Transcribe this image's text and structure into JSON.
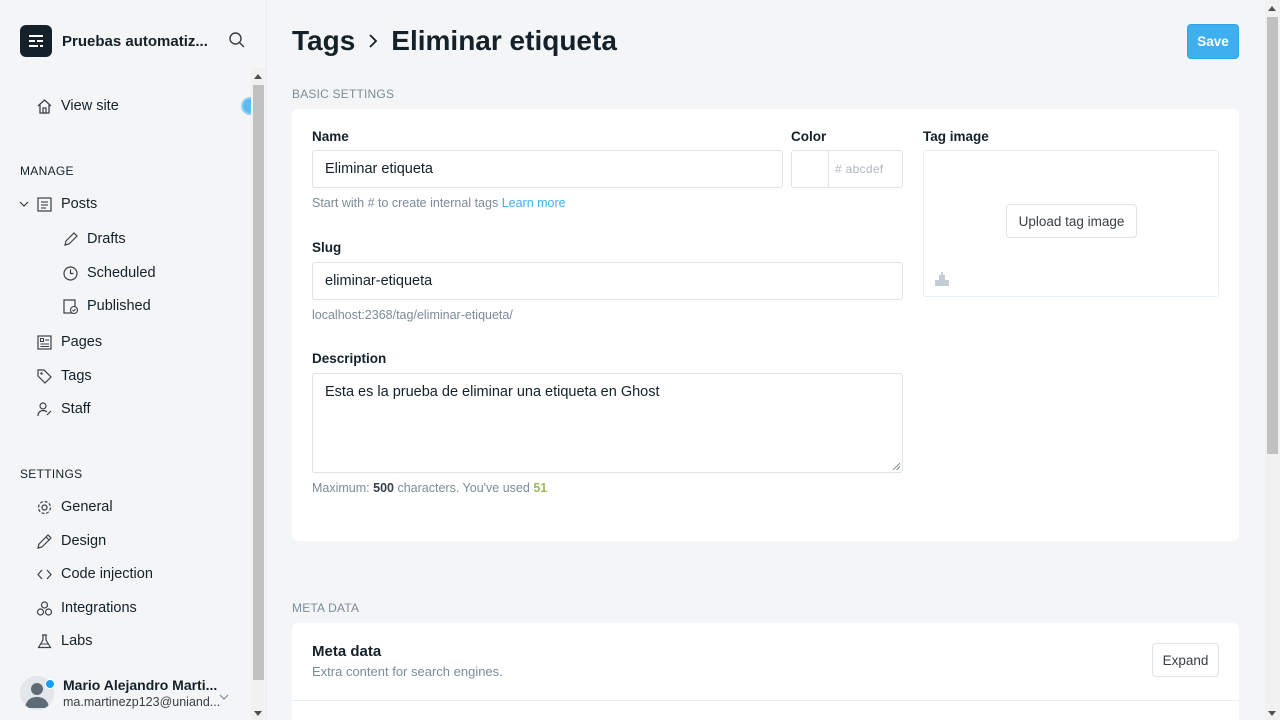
{
  "sidebar": {
    "blog_title": "Pruebas automatiz...",
    "view_site": "View site",
    "manage_heading": "MANAGE",
    "posts": "Posts",
    "drafts": "Drafts",
    "scheduled": "Scheduled",
    "published": "Published",
    "pages": "Pages",
    "tags": "Tags",
    "staff": "Staff",
    "settings_heading": "SETTINGS",
    "general": "General",
    "design": "Design",
    "code_injection": "Code injection",
    "integrations": "Integrations",
    "labs": "Labs",
    "user_name": "Mario Alejandro Marti...",
    "user_email": "ma.martinezp123@uniand..."
  },
  "header": {
    "breadcrumb_parent": "Tags",
    "breadcrumb_current": "Eliminar etiqueta",
    "save_label": "Save"
  },
  "basic": {
    "section_label": "BASIC SETTINGS",
    "name_label": "Name",
    "name_value": "Eliminar etiqueta",
    "name_hint": "Start with # to create internal tags",
    "learn_more": "Learn more",
    "color_label": "Color",
    "color_placeholder": "# abcdef",
    "tag_image_label": "Tag image",
    "upload_label": "Upload tag image",
    "slug_label": "Slug",
    "slug_value": "eliminar-etiqueta",
    "slug_url": "localhost:2368/tag/eliminar-etiqueta/",
    "description_label": "Description",
    "description_value": "Esta es la prueba de eliminar una etiqueta en Ghost",
    "max_prefix": "Maximum:",
    "max_value": "500",
    "max_suffix": "characters. You've used",
    "used_value": "51"
  },
  "meta": {
    "section_label": "META DATA",
    "title": "Meta data",
    "subtitle": "Extra content for search engines.",
    "expand_label": "Expand"
  },
  "colors": {
    "accent": "#3eb0ef",
    "counter_green": "#9fbb58"
  },
  "icons": [
    "search-icon",
    "home-icon",
    "posts-icon",
    "pencil-icon",
    "clock-icon",
    "published-icon",
    "pages-icon",
    "tag-icon",
    "staff-icon",
    "gear-icon",
    "design-icon",
    "code-icon",
    "integrations-icon",
    "labs-icon",
    "image-icon"
  ]
}
